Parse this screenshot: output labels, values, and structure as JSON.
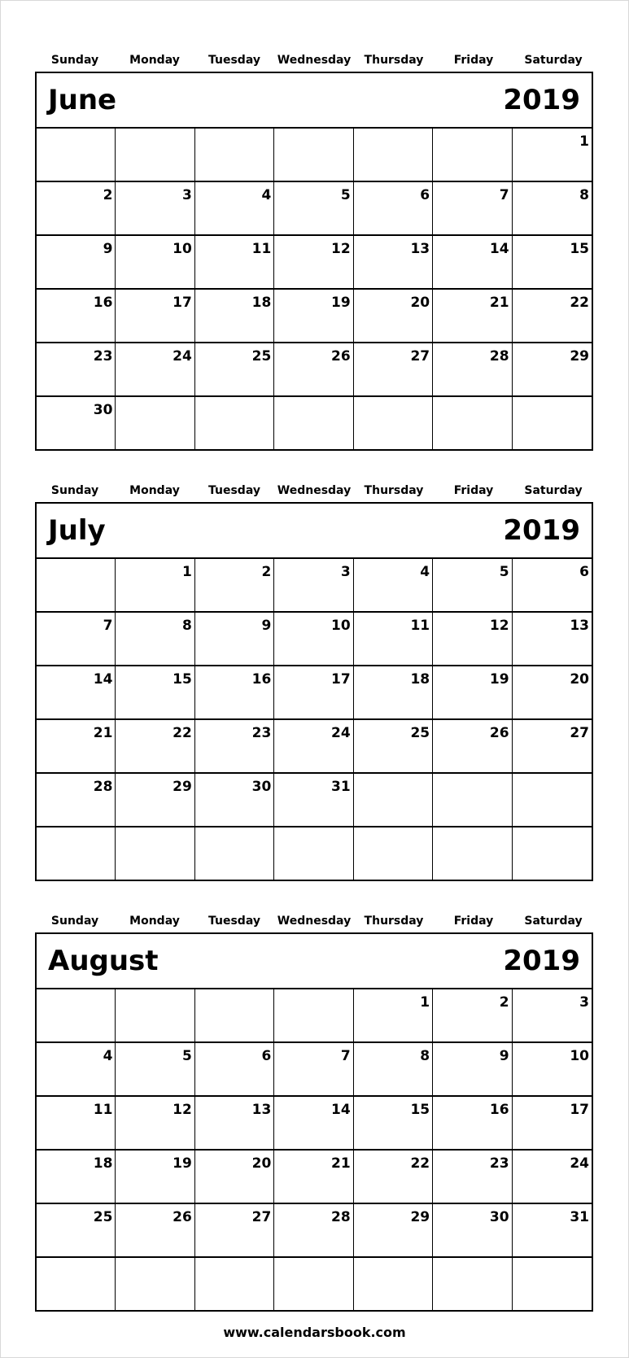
{
  "weekdays": [
    "Sunday",
    "Monday",
    "Tuesday",
    "Wednesday",
    "Thursday",
    "Friday",
    "Saturday"
  ],
  "months": [
    {
      "name": "June",
      "year": "2019",
      "weeks": [
        [
          "",
          "",
          "",
          "",
          "",
          "",
          "1"
        ],
        [
          "2",
          "3",
          "4",
          "5",
          "6",
          "7",
          "8"
        ],
        [
          "9",
          "10",
          "11",
          "12",
          "13",
          "14",
          "15"
        ],
        [
          "16",
          "17",
          "18",
          "19",
          "20",
          "21",
          "22"
        ],
        [
          "23",
          "24",
          "25",
          "26",
          "27",
          "28",
          "29"
        ],
        [
          "30",
          "",
          "",
          "",
          "",
          "",
          ""
        ]
      ]
    },
    {
      "name": "July",
      "year": "2019",
      "weeks": [
        [
          "",
          "1",
          "2",
          "3",
          "4",
          "5",
          "6"
        ],
        [
          "7",
          "8",
          "9",
          "10",
          "11",
          "12",
          "13"
        ],
        [
          "14",
          "15",
          "16",
          "17",
          "18",
          "19",
          "20"
        ],
        [
          "21",
          "22",
          "23",
          "24",
          "25",
          "26",
          "27"
        ],
        [
          "28",
          "29",
          "30",
          "31",
          "",
          "",
          ""
        ],
        [
          "",
          "",
          "",
          "",
          "",
          "",
          ""
        ]
      ]
    },
    {
      "name": "August",
      "year": "2019",
      "weeks": [
        [
          "",
          "",
          "",
          "",
          "1",
          "2",
          "3"
        ],
        [
          "4",
          "5",
          "6",
          "7",
          "8",
          "9",
          "10"
        ],
        [
          "11",
          "12",
          "13",
          "14",
          "15",
          "16",
          "17"
        ],
        [
          "18",
          "19",
          "20",
          "21",
          "22",
          "23",
          "24"
        ],
        [
          "25",
          "26",
          "27",
          "28",
          "29",
          "30",
          "31"
        ],
        [
          "",
          "",
          "",
          "",
          "",
          "",
          ""
        ]
      ]
    }
  ],
  "footer": {
    "website": "www.calendarsbook.com"
  }
}
